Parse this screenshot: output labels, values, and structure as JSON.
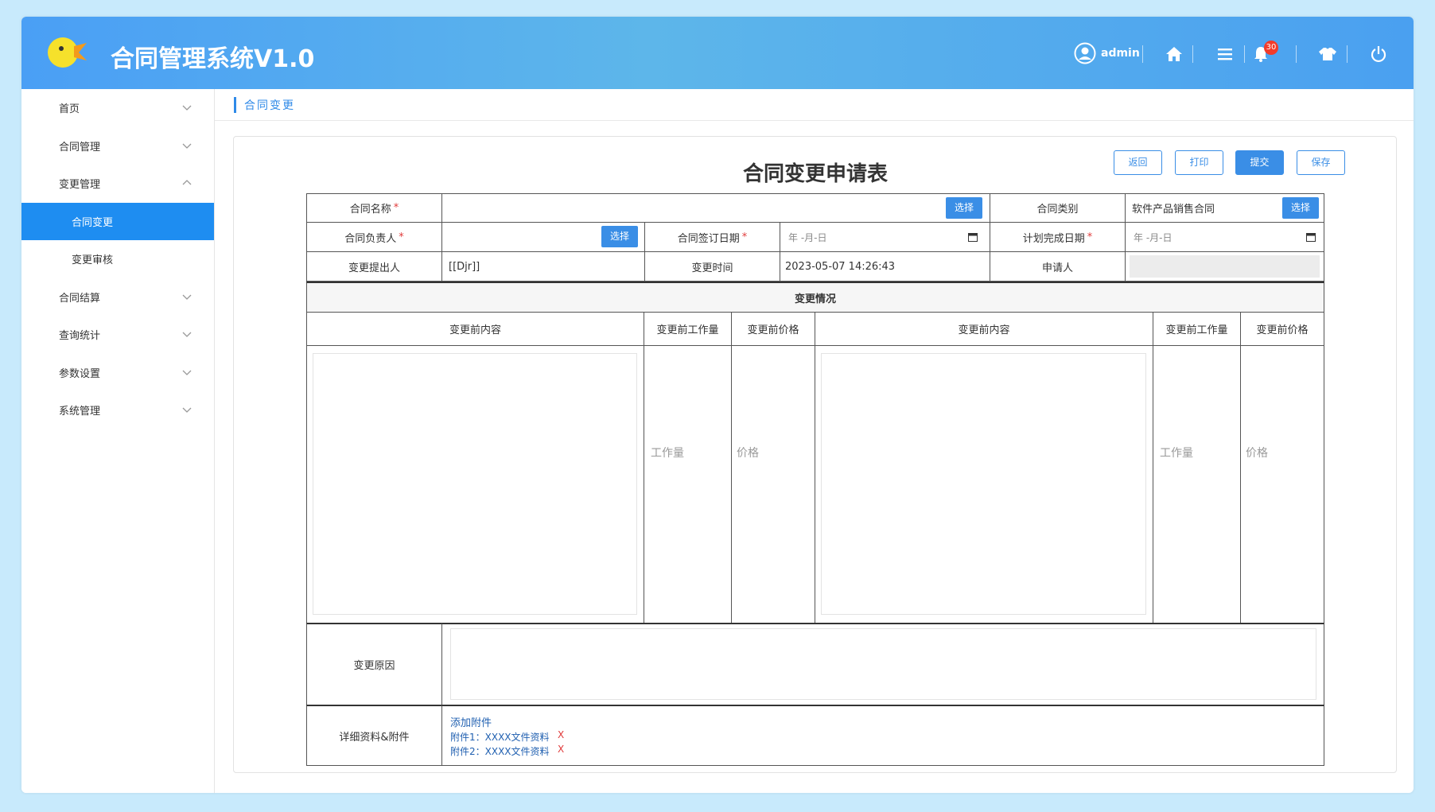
{
  "app": {
    "title": "合同管理系统V1.0"
  },
  "header": {
    "username": "admin",
    "notification_count": "30",
    "icons": [
      "user-avatar-icon",
      "home-icon",
      "menu-icon",
      "bell-icon",
      "shirt-icon",
      "power-icon"
    ]
  },
  "sidebar": {
    "items": [
      {
        "label": "首页"
      },
      {
        "label": "合同管理"
      },
      {
        "label": "变更管理"
      },
      {
        "label": "合同变更"
      },
      {
        "label": "变更审核"
      },
      {
        "label": "合同结算"
      },
      {
        "label": "查询统计"
      },
      {
        "label": "参数设置"
      },
      {
        "label": "系统管理"
      }
    ]
  },
  "breadcrumb": {
    "current": "合同变更"
  },
  "form": {
    "title": "合同变更申请表",
    "buttons": {
      "back": "返回",
      "print": "打印",
      "submit": "提交",
      "save": "保存"
    },
    "labels": {
      "contract_name": "合同名称",
      "contract_type": "合同类别",
      "owner": "合同负责人",
      "sign_date": "合同签订日期",
      "plan_date": "计划完成日期",
      "proposer": "变更提出人",
      "change_time": "变更时间",
      "applicant": "申请人",
      "section": "变更情况",
      "before_content": "变更前内容",
      "before_workload": "变更前工作量",
      "before_price": "变更前价格",
      "before_content_2": "变更前内容",
      "before_workload_2": "变更前工作量",
      "before_price_2": "变更前价格",
      "reason": "变更原因",
      "attachments": "详细资料&附件"
    },
    "required_mark": "*",
    "select_label": "选择",
    "values": {
      "contract_type": "软件产品销售合同",
      "proposer": "[[Djr]]",
      "change_time": "2023-05-07 14:26:43",
      "date_placeholder": "年 -月-日"
    },
    "placeholders": {
      "workload": "工作量",
      "price": "价格"
    },
    "attach": {
      "add": "添加附件",
      "files": [
        {
          "label": "附件1：XXXX文件资料",
          "remove": "X"
        },
        {
          "label": "附件2：XXXX文件资料",
          "remove": "X"
        }
      ]
    }
  },
  "colors": {
    "accent": "#3a8ee6",
    "active_menu": "#1e8df1",
    "required": "#e03b3b"
  }
}
